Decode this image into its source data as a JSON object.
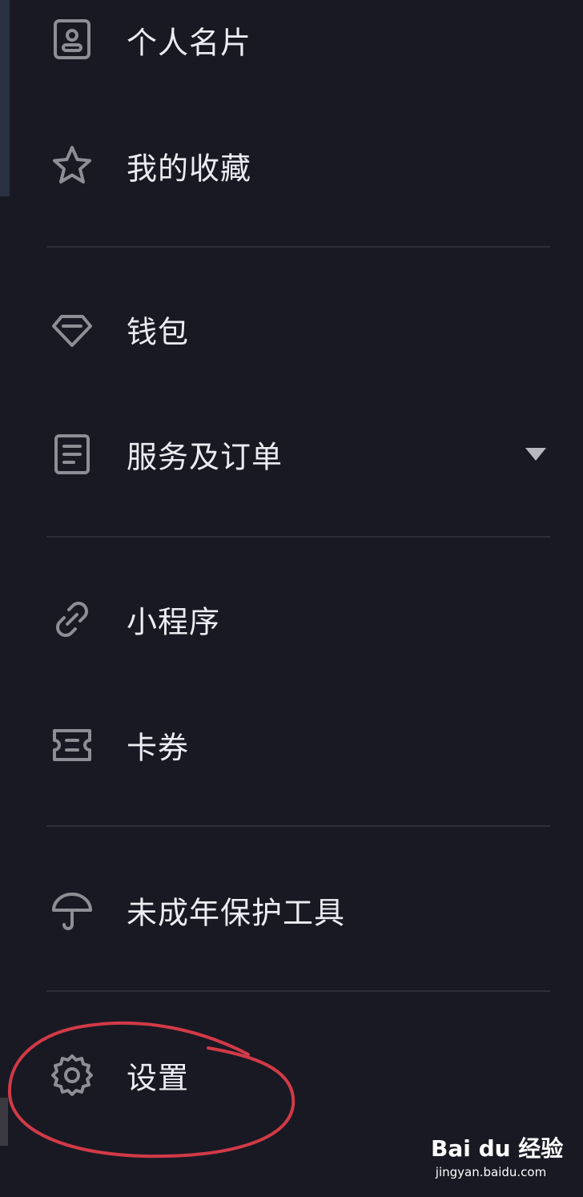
{
  "menu": {
    "items": [
      {
        "label": "个人名片",
        "icon": "id-card-icon"
      },
      {
        "label": "我的收藏",
        "icon": "star-icon"
      },
      {
        "label": "钱包",
        "icon": "diamond-icon"
      },
      {
        "label": "服务及订单",
        "icon": "document-icon",
        "expandable": true
      },
      {
        "label": "小程序",
        "icon": "link-icon"
      },
      {
        "label": "卡券",
        "icon": "ticket-icon"
      },
      {
        "label": "未成年保护工具",
        "icon": "umbrella-icon"
      },
      {
        "label": "设置",
        "icon": "gear-icon"
      }
    ]
  },
  "annotation": {
    "color": "#d23a47"
  },
  "watermark": {
    "main": "Bai du 经验",
    "sub": "jingyan.baidu.com"
  },
  "colors": {
    "background": "#191923",
    "text": "#ececf2",
    "icon": "#8e8e96",
    "divider": "#2e2e38"
  }
}
